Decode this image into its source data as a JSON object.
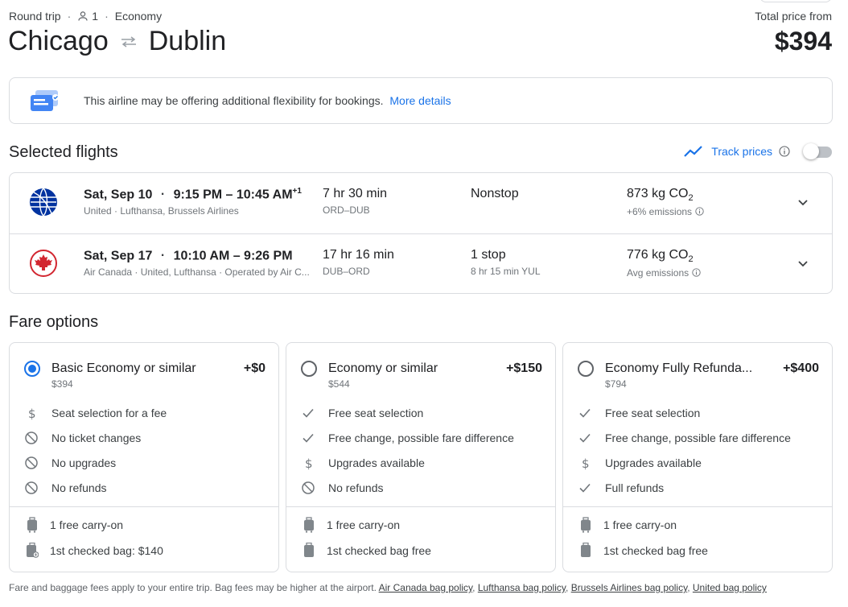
{
  "header": {
    "trip_type": "Round trip",
    "passengers": "1",
    "cabin": "Economy",
    "origin": "Chicago",
    "destination": "Dublin",
    "price_label": "Total price from",
    "price": "$394"
  },
  "banner": {
    "message": "This airline may be offering additional flexibility for bookings.",
    "link": "More details"
  },
  "selected": {
    "title": "Selected flights",
    "track_label": "Track prices"
  },
  "flights": [
    {
      "date": "Sat, Sep 10",
      "times": "9:15 PM – 10:45 AM",
      "day_offset": "+1",
      "airlines": "United · Lufthansa, Brussels Airlines",
      "duration": "7 hr 30 min",
      "airports": "ORD–DUB",
      "stops": "Nonstop",
      "stops_detail": "",
      "co2": "873 kg CO",
      "co2_sub": "2",
      "emissions": "+6% emissions",
      "logo": "united-globe-icon"
    },
    {
      "date": "Sat, Sep 17",
      "times": "10:10 AM – 9:26 PM",
      "day_offset": "",
      "airlines": "Air Canada · United, Lufthansa · Operated by Air C...",
      "duration": "17 hr 16 min",
      "airports": "DUB–ORD",
      "stops": "1 stop",
      "stops_detail": "8 hr 15 min YUL",
      "co2": "776 kg CO",
      "co2_sub": "2",
      "emissions": "Avg emissions",
      "logo": "maple-leaf-icon"
    }
  ],
  "fare_options": {
    "title": "Fare options",
    "fares": [
      {
        "name_bold": "Basic Economy",
        "name_rest": " or similar",
        "add": "+$0",
        "price": "$394",
        "selected": true,
        "features": [
          {
            "icon": "dollar-icon",
            "text": "Seat selection for a fee"
          },
          {
            "icon": "block-icon",
            "text": "No ticket changes"
          },
          {
            "icon": "block-icon",
            "text": "No upgrades"
          },
          {
            "icon": "block-icon",
            "text": "No refunds"
          }
        ],
        "bags": [
          {
            "icon": "carry-on-icon",
            "text": "1 free carry-on"
          },
          {
            "icon": "checked-bag-fee-icon",
            "text": "1st checked bag: $140"
          }
        ]
      },
      {
        "name_bold": "Economy",
        "name_rest": " or similar",
        "add": "+$150",
        "price": "$544",
        "selected": false,
        "features": [
          {
            "icon": "check-icon",
            "text": "Free seat selection"
          },
          {
            "icon": "check-icon",
            "text": "Free change, possible fare difference"
          },
          {
            "icon": "dollar-icon",
            "text": "Upgrades available"
          },
          {
            "icon": "block-icon",
            "text": "No refunds"
          }
        ],
        "bags": [
          {
            "icon": "carry-on-icon",
            "text": "1 free carry-on"
          },
          {
            "icon": "checked-bag-icon",
            "text": "1st checked bag free"
          }
        ]
      },
      {
        "name_bold": "Economy Fully Refunda...",
        "name_rest": "",
        "add": "+$400",
        "price": "$794",
        "selected": false,
        "features": [
          {
            "icon": "check-icon",
            "text": "Free seat selection"
          },
          {
            "icon": "check-icon",
            "text": "Free change, possible fare difference"
          },
          {
            "icon": "dollar-icon",
            "text": "Upgrades available"
          },
          {
            "icon": "check-icon",
            "text": "Full refunds"
          }
        ],
        "bags": [
          {
            "icon": "carry-on-icon",
            "text": "1 free carry-on"
          },
          {
            "icon": "checked-bag-icon",
            "text": "1st checked bag free"
          }
        ]
      }
    ]
  },
  "footer": {
    "text": "Fare and baggage fees apply to your entire trip. Bag fees may be higher at the airport.",
    "links": [
      "Air Canada bag policy",
      "Lufthansa bag policy",
      "Brussels Airlines bag policy",
      "United bag policy"
    ]
  },
  "colors": {
    "accent": "#1a73e8",
    "text": "#202124",
    "muted": "#70757a",
    "border": "#dadce0",
    "air_canada_red": "#d22630",
    "united_blue": "#0033a0"
  }
}
